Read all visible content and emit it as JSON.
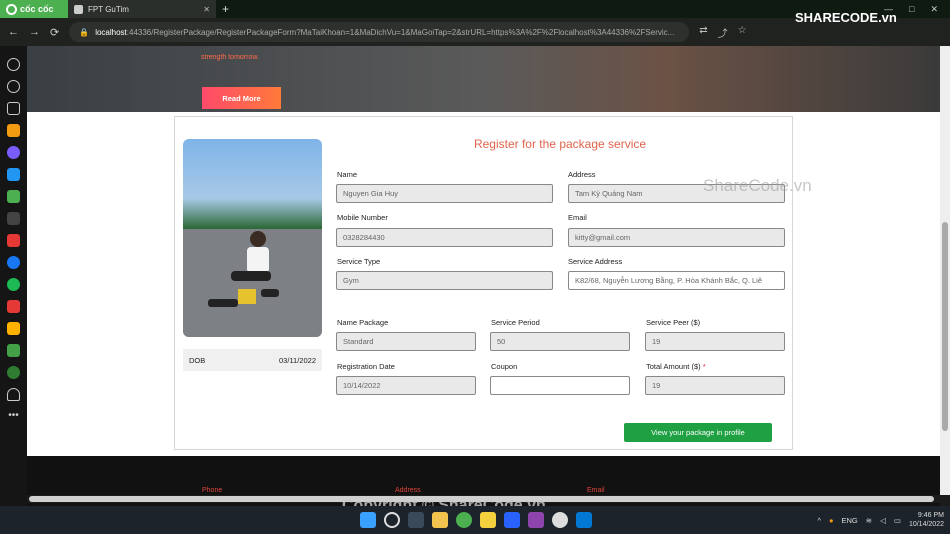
{
  "browser": {
    "brand": "cốc cốc",
    "tab_title": "FPT GuTim",
    "new_tab": "+",
    "url_host": "localhost",
    "url_path": ":44336/RegisterPackage/RegisterPackageForm?MaTaiKhoan=1&MaDichVu=1&MaGoiTap=2&strURL=https%3A%2F%2Flocalhost%3A44336%2FServic..."
  },
  "hero": {
    "text": "strength tomorrow.",
    "button": "Read More"
  },
  "form": {
    "title": "Register for the package service",
    "dob_label": "DOB",
    "dob_value": "03/11/2022",
    "name_label": "Name",
    "name_value": "Nguyen Gia Huy",
    "address_label": "Address",
    "address_value": "Tam Kỳ Quảng Nam",
    "mobile_label": "Mobile Number",
    "mobile_value": "0328284430",
    "email_label": "Email",
    "email_value": "kitty@gmail.com",
    "service_type_label": "Service Type",
    "service_type_value": "Gym",
    "service_address_label": "Service Address",
    "service_address_value": "K82/68, Nguyễn Lương Bằng, P. Hòa Khánh Bắc, Q. Liê",
    "package_label": "Name Package",
    "package_value": "Standard",
    "period_label": "Service Period",
    "period_value": "50",
    "peer_label": "Service Peer ($)",
    "peer_value": "19",
    "regdate_label": "Registration Date",
    "regdate_value": "10/14/2022",
    "coupon_label": "Coupon",
    "coupon_value": "",
    "total_label": "Total Amount ($)",
    "total_required": "*",
    "total_value": "19",
    "view_button": "View your package in profile"
  },
  "footer": {
    "phone": "Phone",
    "address": "Address",
    "email": "Email"
  },
  "watermarks": {
    "logo": "SHARECODE.vn",
    "mid": "ShareCode.vn",
    "bottom": "Copyright © ShareCode.vn"
  },
  "taskbar": {
    "lang": "ENG",
    "time": "9:46 PM",
    "date": "10/14/2022"
  }
}
